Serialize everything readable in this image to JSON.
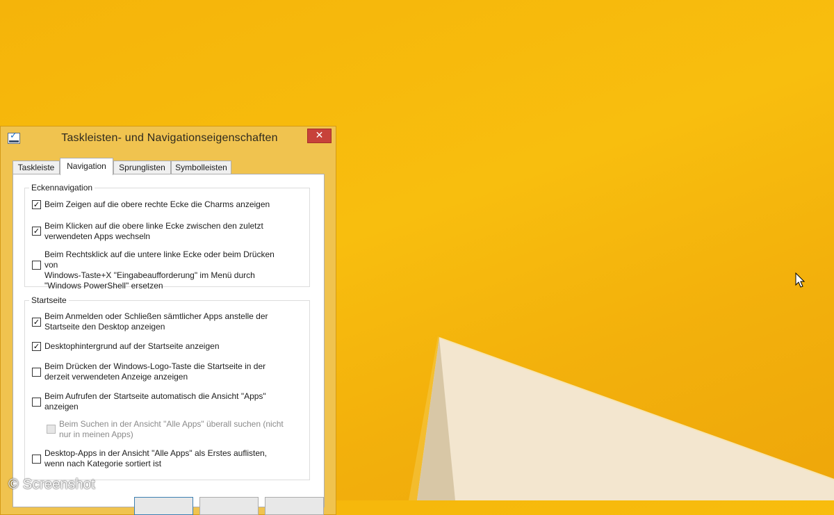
{
  "dialog": {
    "title": "Taskleisten- und Navigationseigenschaften",
    "close_glyph": "✕",
    "tabs": [
      {
        "label": "Taskleiste",
        "active": false
      },
      {
        "label": "Navigation",
        "active": true
      },
      {
        "label": "Sprunglisten",
        "active": false
      },
      {
        "label": "Symbolleisten",
        "active": false
      }
    ],
    "corner_group": {
      "label": "Eckennavigation",
      "options": [
        {
          "checked": true,
          "enabled": true,
          "text": "Beim Zeigen auf die obere rechte Ecke die Charms anzeigen"
        },
        {
          "checked": true,
          "enabled": true,
          "text": "Beim Klicken auf die obere linke Ecke zwischen den zuletzt\nverwendeten Apps wechseln"
        },
        {
          "checked": false,
          "enabled": true,
          "text": "Beim Rechtsklick auf die untere linke Ecke oder beim Drücken von\nWindows-Taste+X \"Eingabeaufforderung\" im Menü durch\n\"Windows PowerShell\" ersetzen"
        }
      ]
    },
    "start_group": {
      "label": "Startseite",
      "options": [
        {
          "checked": true,
          "enabled": true,
          "text": "Beim Anmelden oder Schließen sämtlicher Apps anstelle der\nStartseite den Desktop anzeigen"
        },
        {
          "checked": true,
          "enabled": true,
          "text": "Desktophintergrund auf der Startseite anzeigen"
        },
        {
          "checked": false,
          "enabled": true,
          "text": "Beim Drücken der Windows-Logo-Taste die Startseite in der\nderzeit verwendeten Anzeige anzeigen"
        },
        {
          "checked": false,
          "enabled": true,
          "text": "Beim Aufrufen der Startseite automatisch die Ansicht \"Apps\"\nanzeigen"
        },
        {
          "checked": false,
          "enabled": false,
          "text": "Beim Suchen in der Ansicht \"Alle Apps\" überall suchen (nicht\nnur in meinen Apps)"
        },
        {
          "checked": false,
          "enabled": true,
          "text": "Desktop-Apps in der Ansicht \"Alle Apps\" als Erstes auflisten,\nwenn nach Kategorie sortiert ist"
        }
      ]
    }
  },
  "watermark": "© Screenshot",
  "check_glyph": "✓",
  "colors": {
    "desktop": "#f8be0e",
    "close_button": "#c7423a",
    "window_frame": "#f0c34f"
  },
  "icons": {
    "app": "taskbar-properties-icon",
    "close": "close-icon",
    "cursor": "mouse-pointer-icon"
  }
}
